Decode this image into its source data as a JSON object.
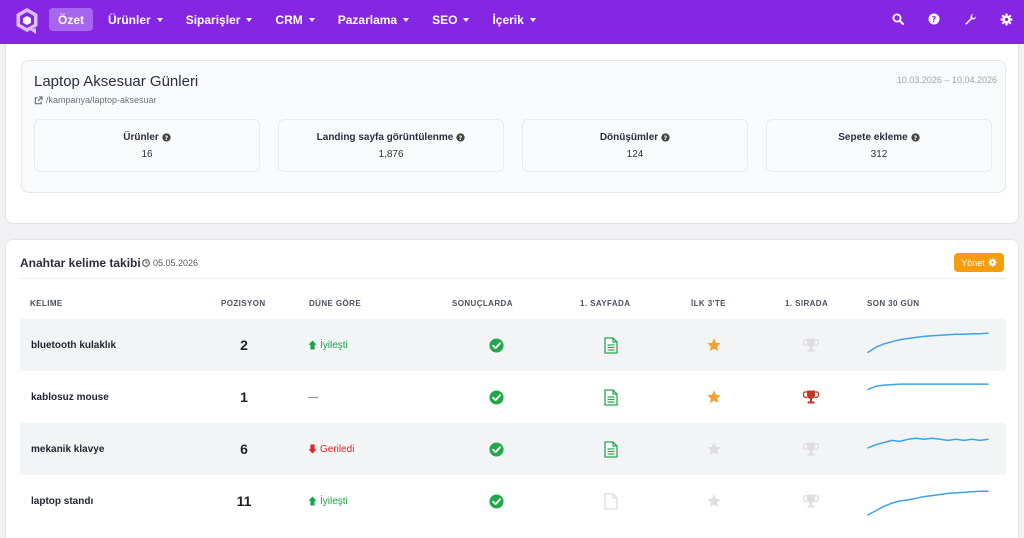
{
  "nav": {
    "items": [
      {
        "label": "Özet",
        "active": true,
        "caret": false
      },
      {
        "label": "Ürünler",
        "caret": true
      },
      {
        "label": "Siparişler",
        "caret": true
      },
      {
        "label": "CRM",
        "caret": true
      },
      {
        "label": "Pazarlama",
        "caret": true
      },
      {
        "label": "SEO",
        "caret": true
      },
      {
        "label": "İçerik",
        "caret": true
      }
    ],
    "icons": [
      "search-icon",
      "help-icon",
      "wrench-icon",
      "gear-icon"
    ]
  },
  "campaign": {
    "title": "Laptop Aksesuar Günleri",
    "link": "/kampanya/laptop-aksesuar",
    "dates": "10.03.2026 – 10.04.2026",
    "stats": [
      {
        "label": "Ürünler",
        "value": "16"
      },
      {
        "label": "Landing sayfa görüntülenme",
        "value": "1,876"
      },
      {
        "label": "Dönüşümler",
        "value": "124"
      },
      {
        "label": "Sepete ekleme",
        "value": "312"
      }
    ]
  },
  "keywords": {
    "title": "Anahtar kelime takibi",
    "date": "05.05.2026",
    "manage_label": "Yönet",
    "columns": [
      "KELIME",
      "POZISYON",
      "DÜNE GÖRE",
      "SONUÇLARDA",
      "1. SAYFADA",
      "İLK 3'TE",
      "1. SIRADA",
      "SON 30 GÜN"
    ],
    "rows": [
      {
        "keyword": "bluetooth kulaklık",
        "position": "2",
        "change": "İyileşti",
        "trend": "up",
        "in_results": true,
        "first_page": true,
        "top3": true,
        "first": false,
        "spark": [
          8,
          13,
          16,
          18,
          20,
          21,
          22,
          23,
          23.5,
          24,
          24.5,
          25,
          25,
          25.5,
          25.5,
          26
        ]
      },
      {
        "keyword": "kablosuz mouse",
        "position": "1",
        "change": "—",
        "trend": "none",
        "in_results": true,
        "first_page": true,
        "top3": true,
        "first": true,
        "spark": [
          22,
          25,
          26,
          26.5,
          27,
          27,
          27,
          27,
          27,
          27,
          27,
          27,
          27,
          27,
          27,
          27
        ]
      },
      {
        "keyword": "mekanik klavye",
        "position": "6",
        "change": "Geriledi",
        "trend": "down",
        "in_results": true,
        "first_page": true,
        "top3": false,
        "first": false,
        "spark": [
          16,
          19,
          21,
          23,
          22,
          24,
          25,
          24,
          25,
          24,
          23,
          24,
          23,
          24,
          23,
          24
        ]
      },
      {
        "keyword": "laptop standı",
        "position": "11",
        "change": "İyileşti",
        "trend": "up",
        "in_results": true,
        "first_page": false,
        "top3": false,
        "first": false,
        "spark": [
          2,
          6,
          10,
          13,
          15,
          16,
          17.5,
          19,
          20,
          21,
          22,
          22.5,
          23,
          23.5,
          24,
          24
        ]
      }
    ]
  },
  "colors": {
    "brand": "#8526e3",
    "green": "#22a84a",
    "orange": "#f0a232",
    "red": "#c0392b",
    "muted": "#dddde2",
    "spark": "#3da3e8"
  }
}
